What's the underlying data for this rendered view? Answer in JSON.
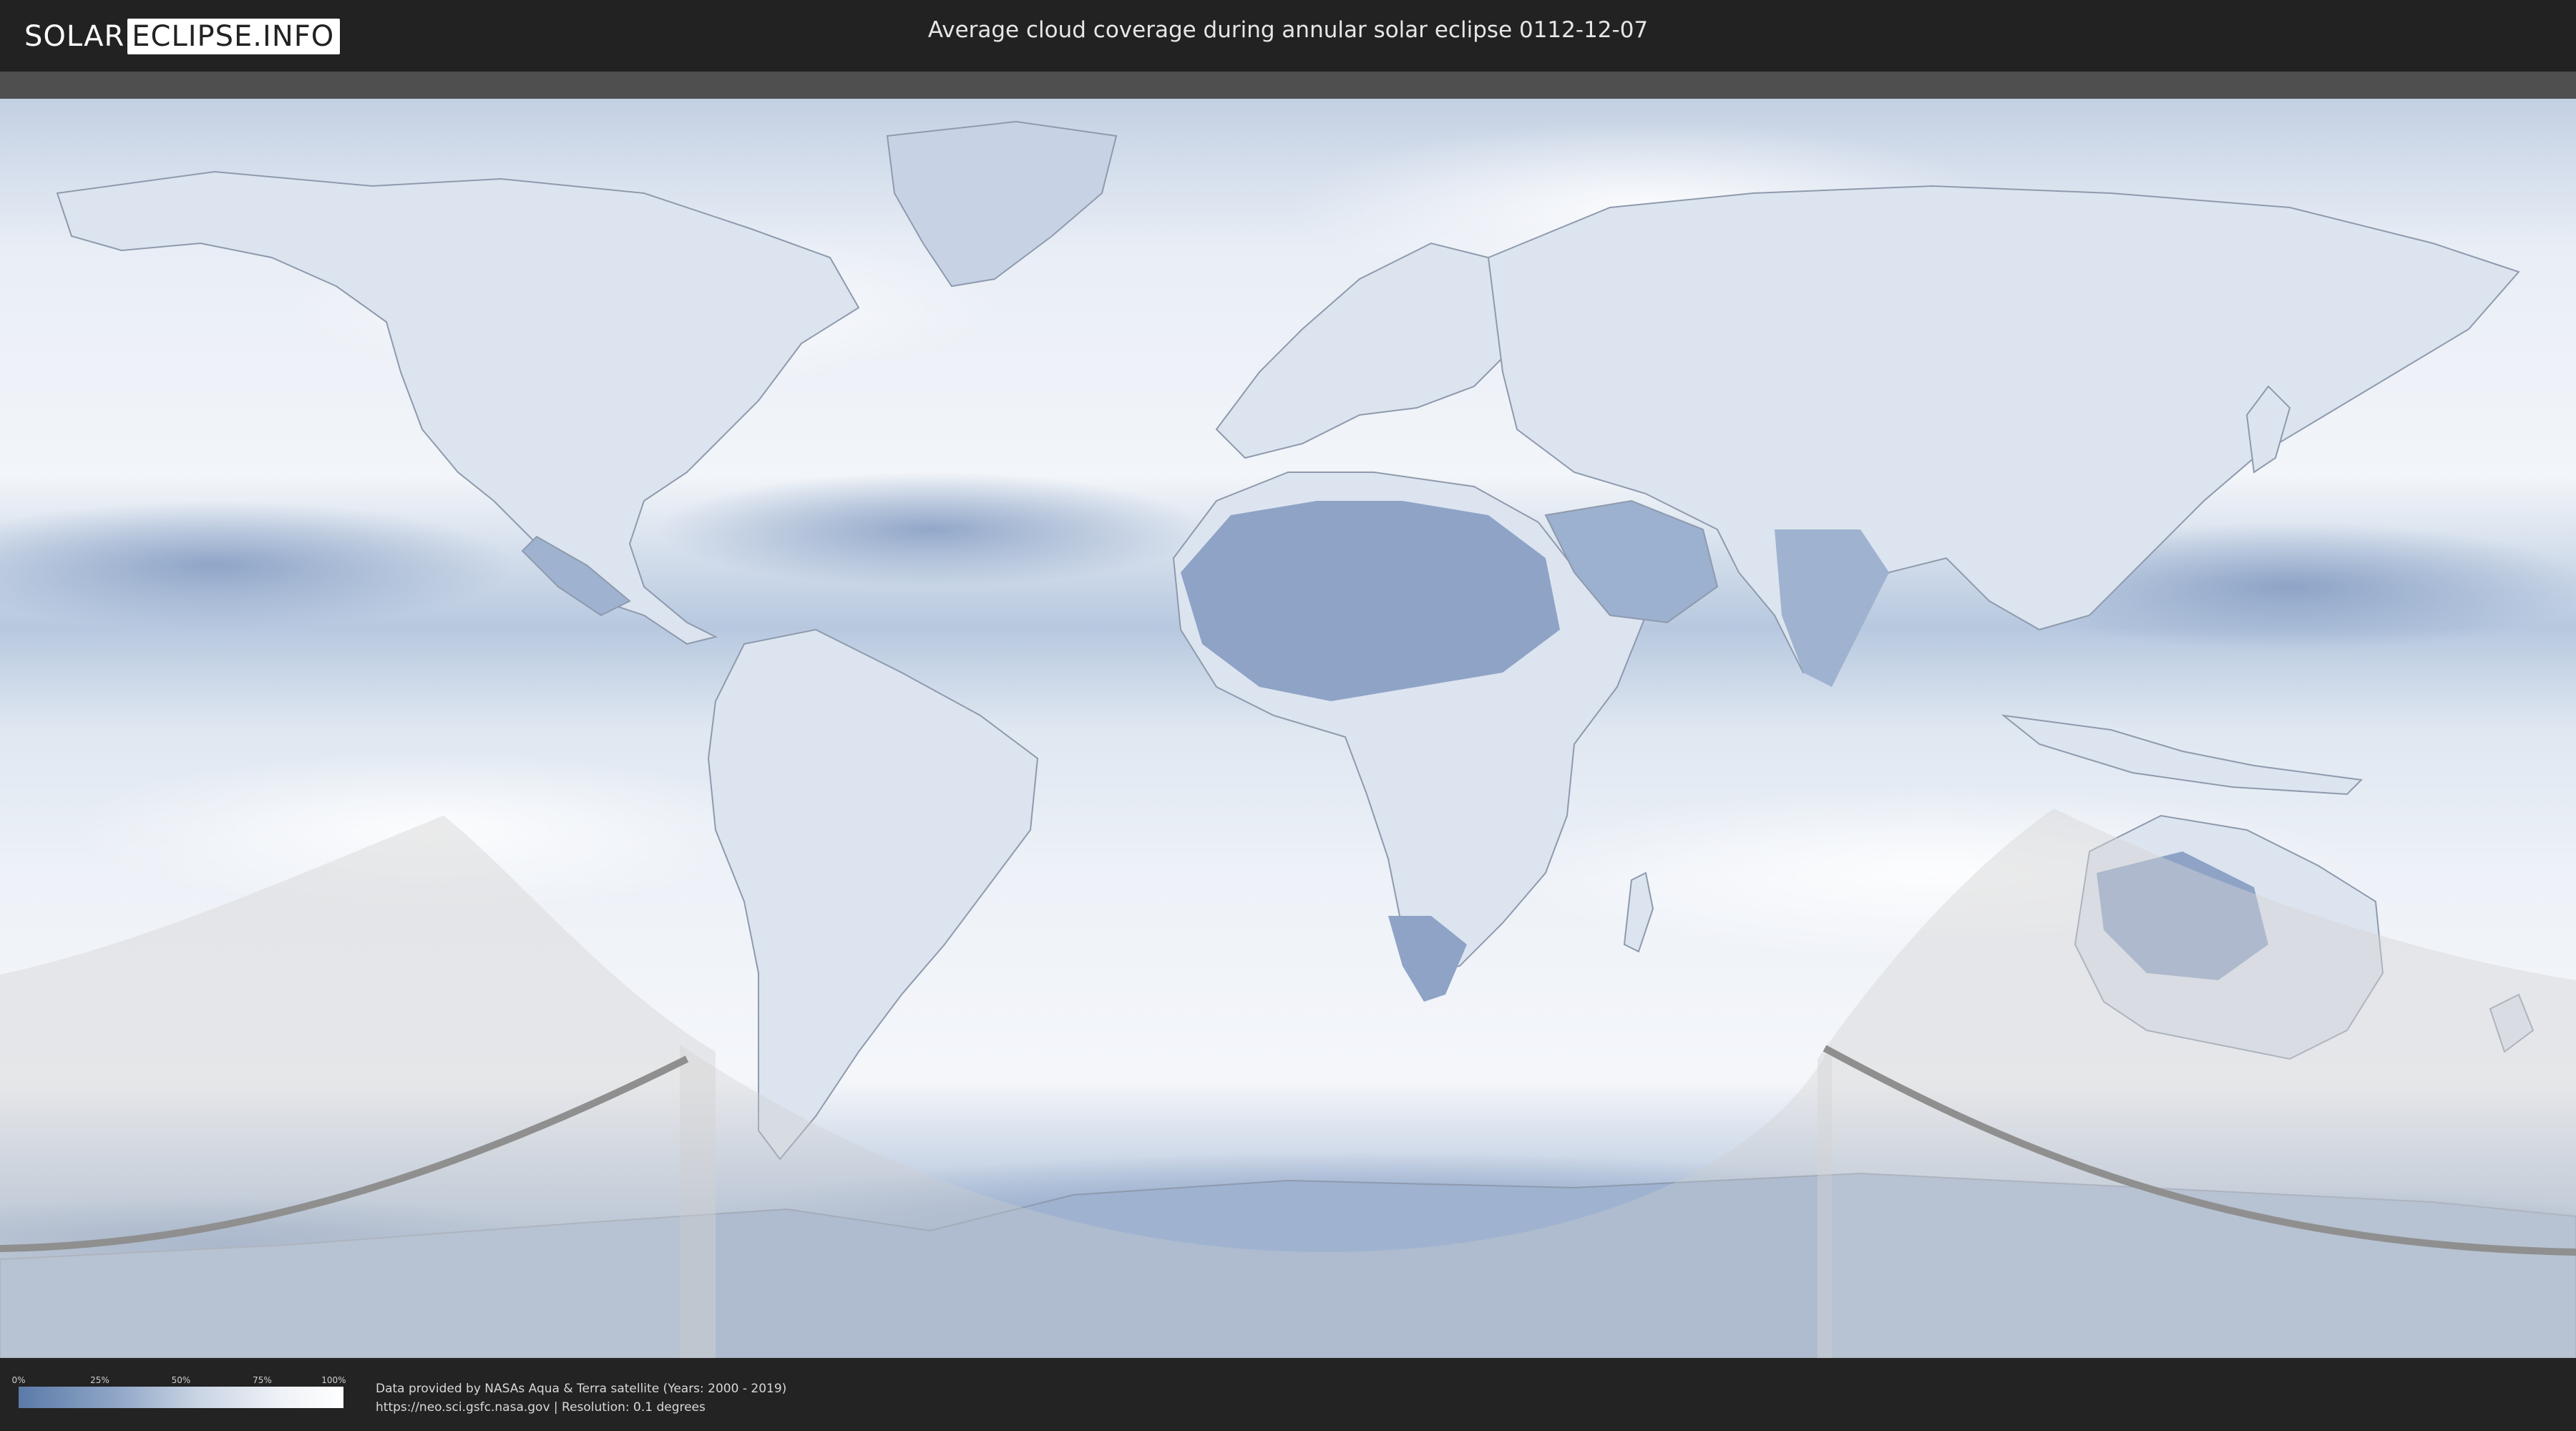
{
  "header": {
    "logo_left": "SOLAR",
    "logo_right": "ECLIPSE.INFO",
    "title": "Average cloud coverage during annular solar eclipse 0112-12-07"
  },
  "map": {
    "description_colors": {
      "cloud_high": "#ffffff",
      "cloud_low": "#5b7aa8",
      "shadow_overlay": "#d9d9d9",
      "path_line": "#8a8a8a"
    }
  },
  "legend": {
    "ticks": [
      "0%",
      "25%",
      "50%",
      "75%",
      "100%"
    ]
  },
  "credits": {
    "line1": "Data provided by NASAs Aqua & Terra satellite (Years: 2000 - 2019)",
    "line2": "https://neo.sci.gsfc.nasa.gov | Resolution: 0.1 degrees"
  }
}
